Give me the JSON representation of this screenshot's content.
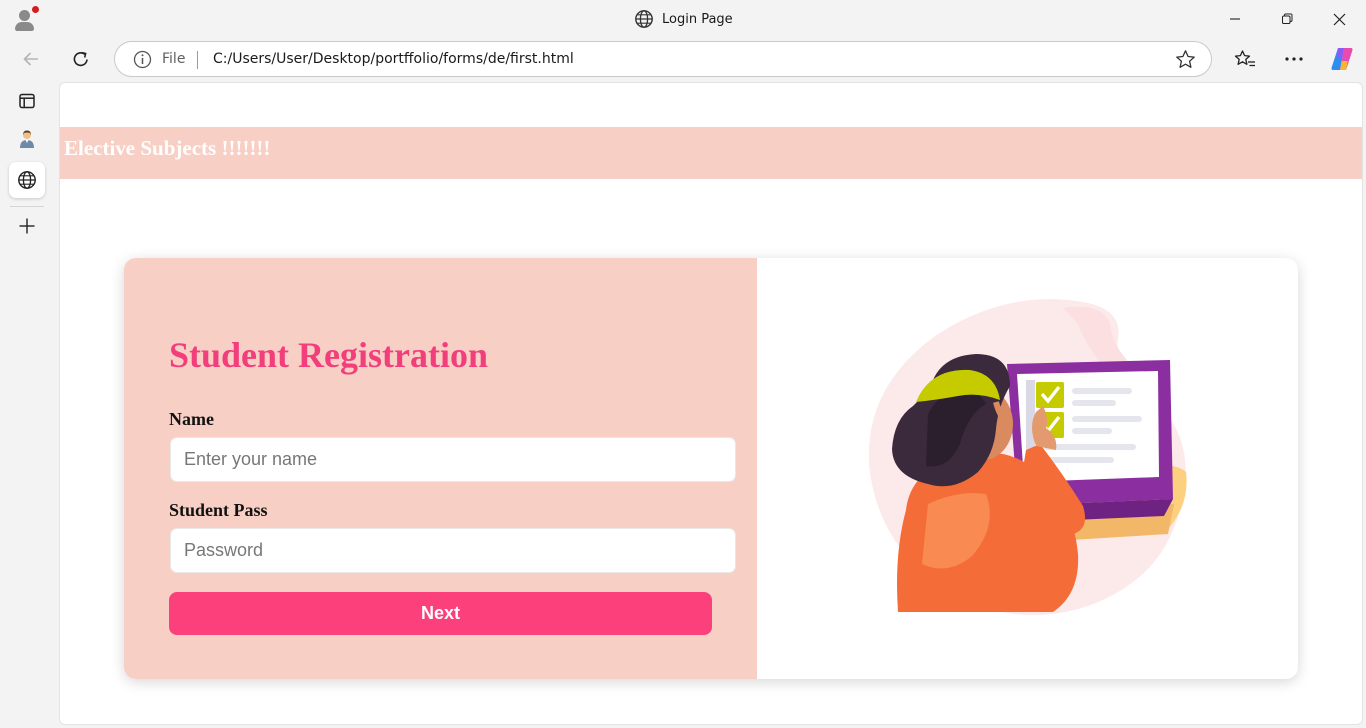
{
  "browser": {
    "window_title": "Login Page",
    "address": {
      "scheme_label": "File",
      "url": "C:/Users/User/Desktop/portffolio/forms/de/first.html"
    }
  },
  "page": {
    "banner_title": "Elective Subjects !!!!!!!",
    "form": {
      "heading": "Student Registration",
      "name_label": "Name",
      "name_placeholder": "Enter your name",
      "name_value": "",
      "pass_label": "Student Pass",
      "pass_placeholder": "Password",
      "pass_value": "",
      "submit_label": "Next"
    }
  },
  "colors": {
    "banner_bg": "#f8cfc5",
    "heading": "#f23e7b",
    "button": "#fb407c"
  },
  "icons": [
    "profile-icon",
    "globe-icon",
    "minimize-icon",
    "restore-icon",
    "close-icon",
    "back-icon",
    "refresh-icon",
    "info-icon",
    "star-icon",
    "favorites-icon",
    "more-icon",
    "copilot-icon",
    "tabs-icon",
    "avatar-icon",
    "plus-icon"
  ]
}
